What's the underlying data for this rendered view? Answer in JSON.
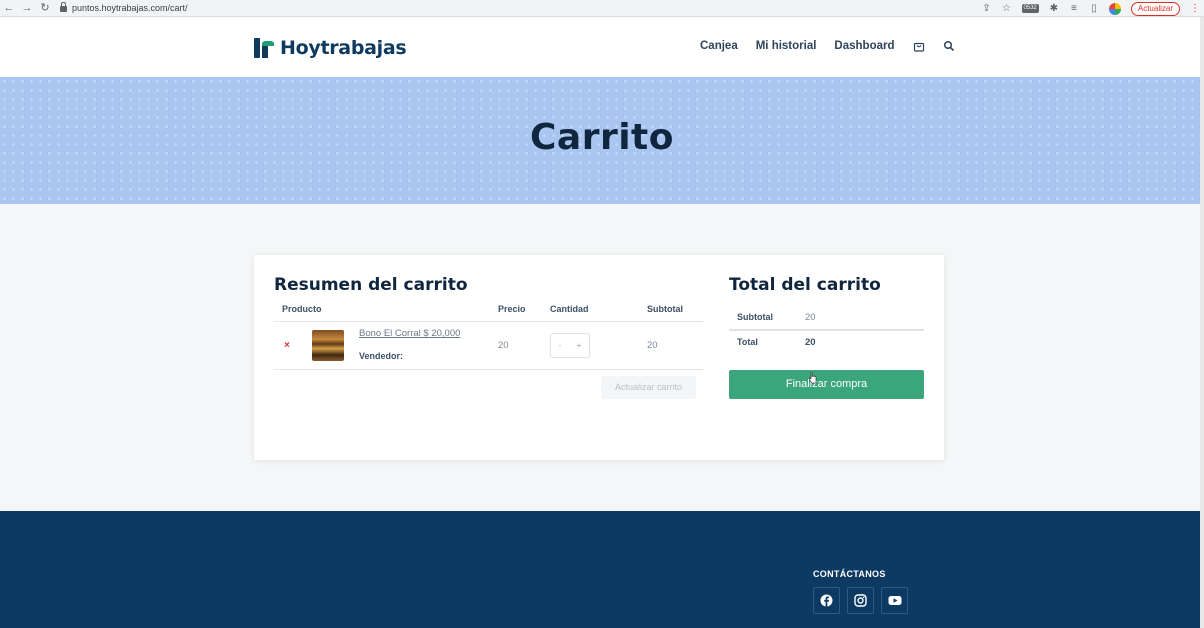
{
  "browser": {
    "url": "puntos.hoytrabajas.com/cart/",
    "update_label": "Actualizar",
    "ext_badge": "0532"
  },
  "header": {
    "logo_text": "Hoytrabajas",
    "nav": [
      "Canjea",
      "Mi historial",
      "Dashboard"
    ]
  },
  "hero": {
    "title": "Carrito"
  },
  "summary": {
    "title": "Resumen del carrito",
    "columns": [
      "Producto",
      "Precio",
      "Cantidad",
      "Subtotal"
    ],
    "item": {
      "name": "Bono El Corral $ 20,000",
      "vendor_label": "Vendedor:",
      "price": "20",
      "qty_minus": "-",
      "qty_plus": "+",
      "subtotal": "20",
      "remove": "×"
    },
    "update_button": "Actualizar carrito"
  },
  "totals": {
    "title": "Total del carrito",
    "subtotal_label": "Subtotal",
    "subtotal_value": "20",
    "total_label": "Total",
    "total_value": "20",
    "checkout_button": "Finalizar compra"
  },
  "footer": {
    "contact_title": "CONTÁCTANOS",
    "social": [
      "facebook-icon",
      "instagram-icon",
      "youtube-icon"
    ]
  },
  "colors": {
    "brand_dark": "#0e3a5f",
    "brand_green": "#3ba67c",
    "hero_bg": "#a8c6ef",
    "footer_bg": "#0c3a62"
  }
}
